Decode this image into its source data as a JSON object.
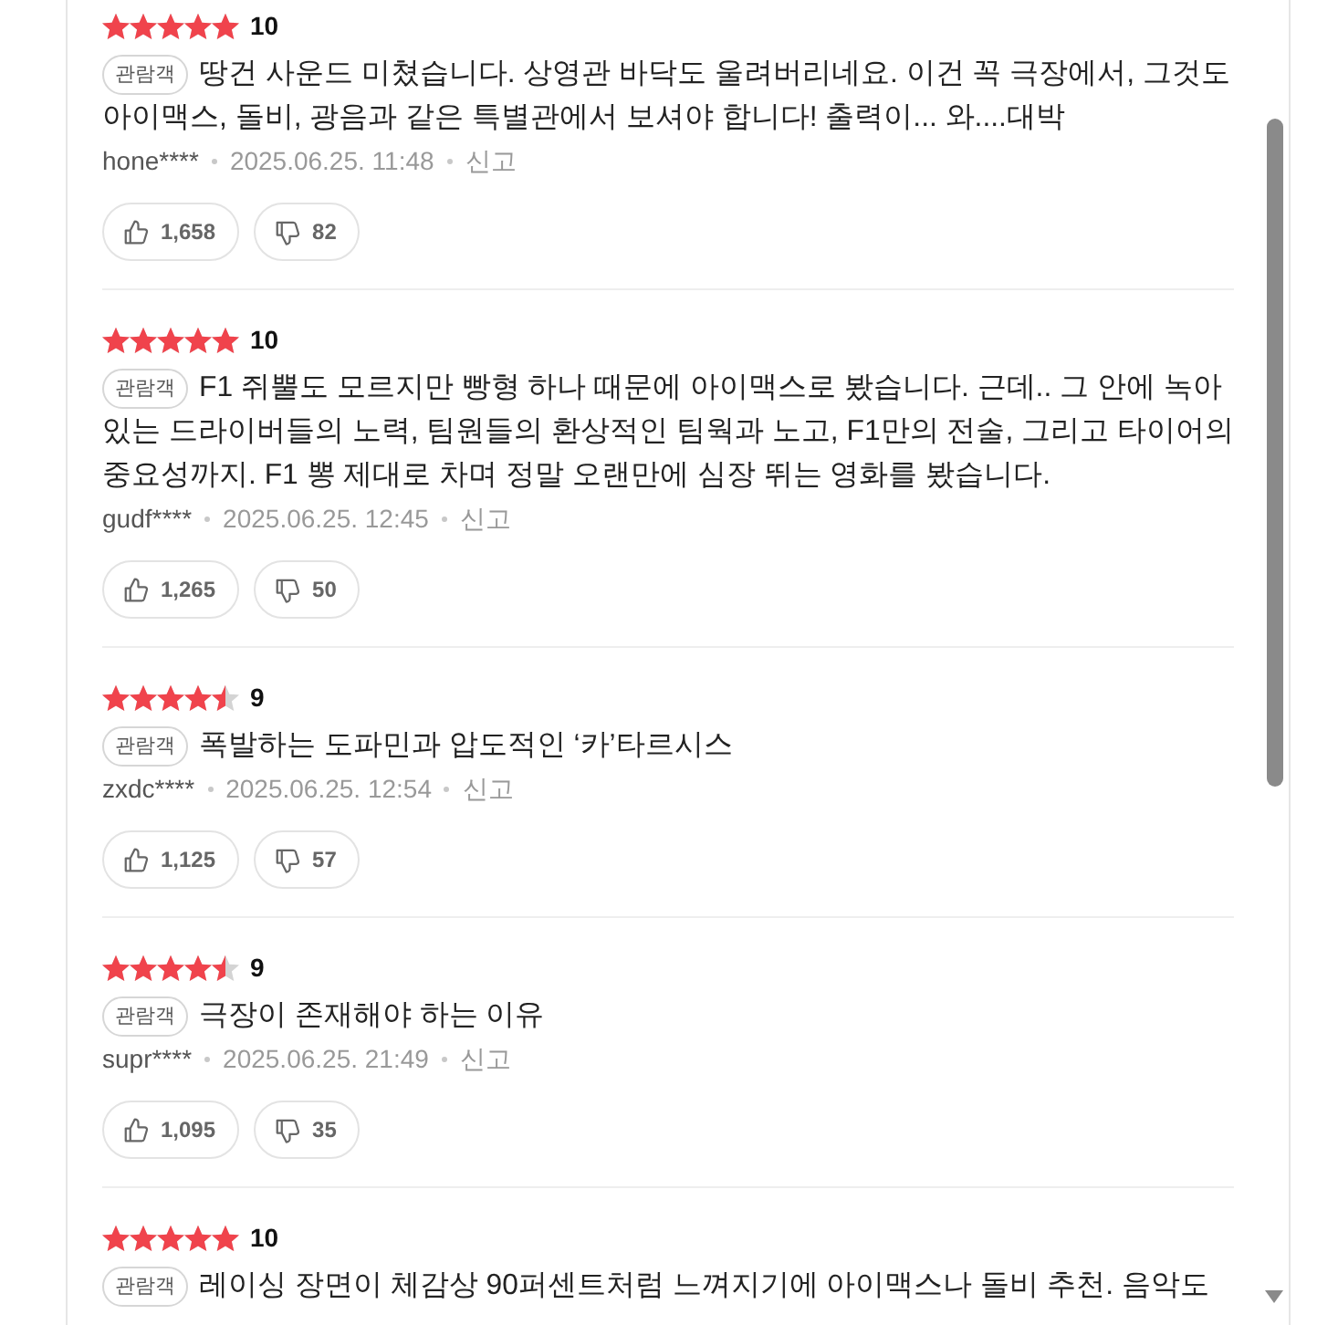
{
  "reviews": [
    {
      "stars": 5,
      "score": "10",
      "badge": "관람객",
      "text": "땅건 사운드 미쳤습니다. 상영관 바닥도 울려버리네요. 이건 꼭 극장에서, 그것도 아이맥스, 돌비, 광음과 같은 특별관에서 보셔야 합니다! 출력이... 와....대박",
      "user": "hone****",
      "date": "2025.06.25. 11:48",
      "report": "신고",
      "likes": "1,658",
      "dislikes": "82"
    },
    {
      "stars": 5,
      "score": "10",
      "badge": "관람객",
      "text": "F1 쥐뿔도 모르지만 빵형 하나 때문에 아이맥스로 봤습니다. 근데.. 그 안에 녹아 있는 드라이버들의 노력, 팀원들의 환상적인 팀웍과 노고, F1만의 전술, 그리고 타이어의 중요성까지. F1 뽕 제대로 차며 정말 오랜만에 심장 뛰는 영화를 봤습니다.",
      "user": "gudf****",
      "date": "2025.06.25. 12:45",
      "report": "신고",
      "likes": "1,265",
      "dislikes": "50"
    },
    {
      "stars": 4.5,
      "score": "9",
      "badge": "관람객",
      "text": "폭발하는 도파민과 압도적인 ‘카’타르시스",
      "user": "zxdc****",
      "date": "2025.06.25. 12:54",
      "report": "신고",
      "likes": "1,125",
      "dislikes": "57"
    },
    {
      "stars": 4.5,
      "score": "9",
      "badge": "관람객",
      "text": "극장이 존재해야 하는 이유",
      "user": "supr****",
      "date": "2025.06.25. 21:49",
      "report": "신고",
      "likes": "1,095",
      "dislikes": "35"
    },
    {
      "stars": 5,
      "score": "10",
      "badge": "관람객",
      "text": "레이싱 장면이 체감상 90퍼센트처럼 느껴지기에 아이맥스나 돌비 추천. 음악도"
    }
  ]
}
